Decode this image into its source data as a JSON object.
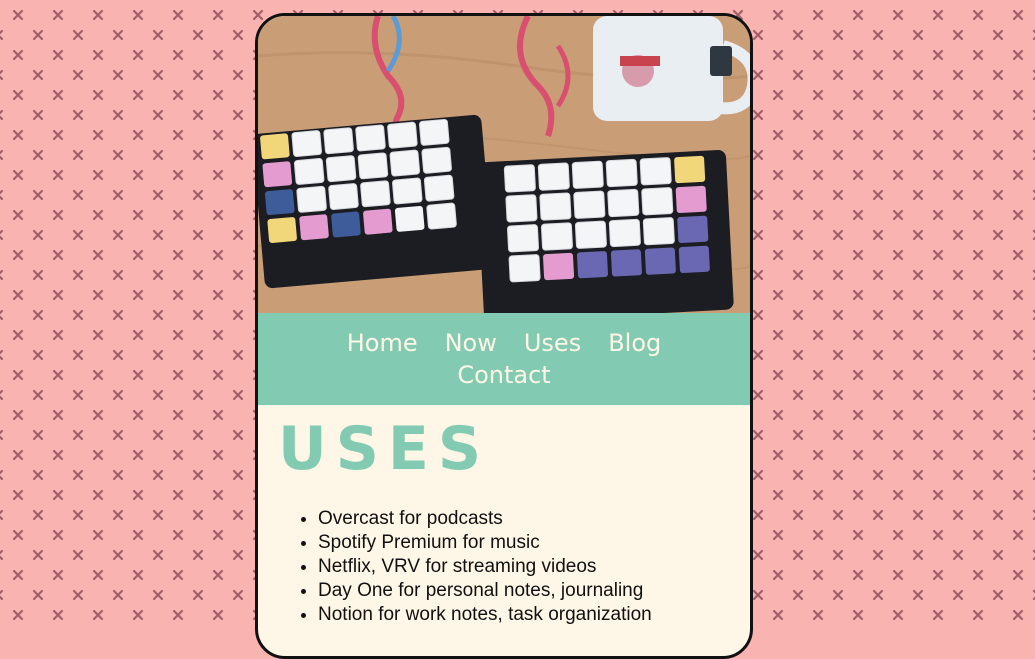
{
  "colors": {
    "page_background": "#f9b4b1",
    "pattern_mark": "#a15e69",
    "accent": "#82cbb2",
    "card_background": "#fef6e6",
    "nav_text": "#fef6e6",
    "border": "#111111"
  },
  "background": {
    "pattern_icon": "x-mark-icon"
  },
  "hero": {
    "description_icon": "split-keyboard-photo"
  },
  "nav": {
    "items": [
      {
        "label": "Home"
      },
      {
        "label": "Now"
      },
      {
        "label": "Uses"
      },
      {
        "label": "Blog"
      },
      {
        "label": "Contact"
      }
    ]
  },
  "page": {
    "title": "USES",
    "items": [
      "Overcast for podcasts",
      "Spotify Premium for music",
      "Netflix, VRV for streaming videos",
      "Day One for personal notes, journaling",
      "Notion for work notes, task organization"
    ]
  }
}
